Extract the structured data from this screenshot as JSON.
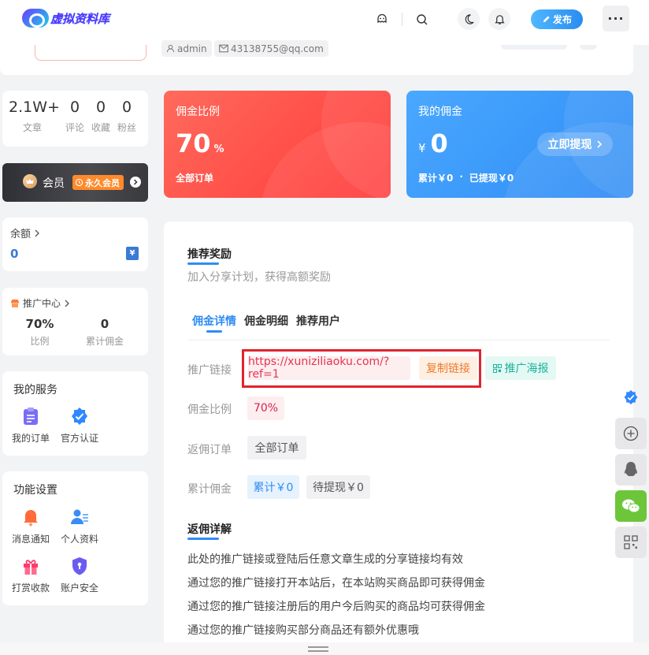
{
  "header": {
    "logo_text": "虚拟资料库",
    "publish_label": "发布",
    "more_label": "···"
  },
  "profile": {
    "username": "admin",
    "email": "43138755@qq.com"
  },
  "stats": [
    {
      "value": "2.1W+",
      "label": "文章"
    },
    {
      "value": "0",
      "label": "评论"
    },
    {
      "value": "0",
      "label": "收藏"
    },
    {
      "value": "0",
      "label": "粉丝"
    }
  ],
  "vip": {
    "label": "会员",
    "badge": "永久会员"
  },
  "balance": {
    "title": "余额",
    "value": "0"
  },
  "promo": {
    "title": "推广中心",
    "items": [
      {
        "value": "70%",
        "label": "比例"
      },
      {
        "value": "0",
        "label": "累计佣金"
      }
    ]
  },
  "services": {
    "title": "我的服务",
    "items": [
      {
        "label": "我的订单",
        "icon": "clipboard-icon",
        "color": "#7b6cf6"
      },
      {
        "label": "官方认证",
        "icon": "verified-badge-icon",
        "color": "#2f88ff"
      }
    ]
  },
  "settings": {
    "title": "功能设置",
    "items": [
      {
        "label": "消息通知",
        "icon": "bell-icon",
        "color": "#ff6b3a"
      },
      {
        "label": "个人资料",
        "icon": "user-card-icon",
        "color": "#3a8df5"
      },
      {
        "label": "打赏收款",
        "icon": "gift-icon",
        "color": "#ff3b6b"
      },
      {
        "label": "账户安全",
        "icon": "shield-icon",
        "color": "#6a5cf0"
      }
    ]
  },
  "commission_rate_card": {
    "title": "佣金比例",
    "value": "70",
    "unit": "%",
    "footer": "全部订单",
    "color_from": "#ff6a5c",
    "color_to": "#ff3a3a"
  },
  "my_commission_card": {
    "title": "我的佣金",
    "currency": "¥",
    "value": "0",
    "withdraw_label": "立即提现",
    "footer_total": "累计￥0",
    "footer_withdrawn": "已提现￥0",
    "color_from": "#4aa8ff",
    "color_to": "#2f8cf5"
  },
  "main": {
    "title": "推荐奖励",
    "subtitle": "加入分享计划，获得高额奖励",
    "tabs": [
      {
        "label": "佣金详情",
        "active": true
      },
      {
        "label": "佣金明细",
        "active": false
      },
      {
        "label": "推荐用户",
        "active": false
      }
    ],
    "rows": {
      "link_label": "推广链接",
      "link_value": "https://xuniziliaoku.com/?ref=1",
      "copy_label": "复制链接",
      "poster_label": "推广海报",
      "rate_label": "佣金比例",
      "rate_value": "70%",
      "orders_label": "返佣订单",
      "orders_value": "全部订单",
      "total_label": "累计佣金",
      "total_value": "累计￥0",
      "pending_value": "待提现￥0"
    },
    "details_title": "返佣详解",
    "details": [
      "此处的推广链接或登陆后任意文章生成的分享链接均有效",
      "通过您的推广链接打开本站后，在本站购买商品即可获得佣金",
      "通过您的推广链接注册后的用户今后购买的商品均可获得佣金",
      "通过您的推广链接购买部分商品还有额外优惠哦"
    ]
  },
  "highlight_color": "#e0242c"
}
